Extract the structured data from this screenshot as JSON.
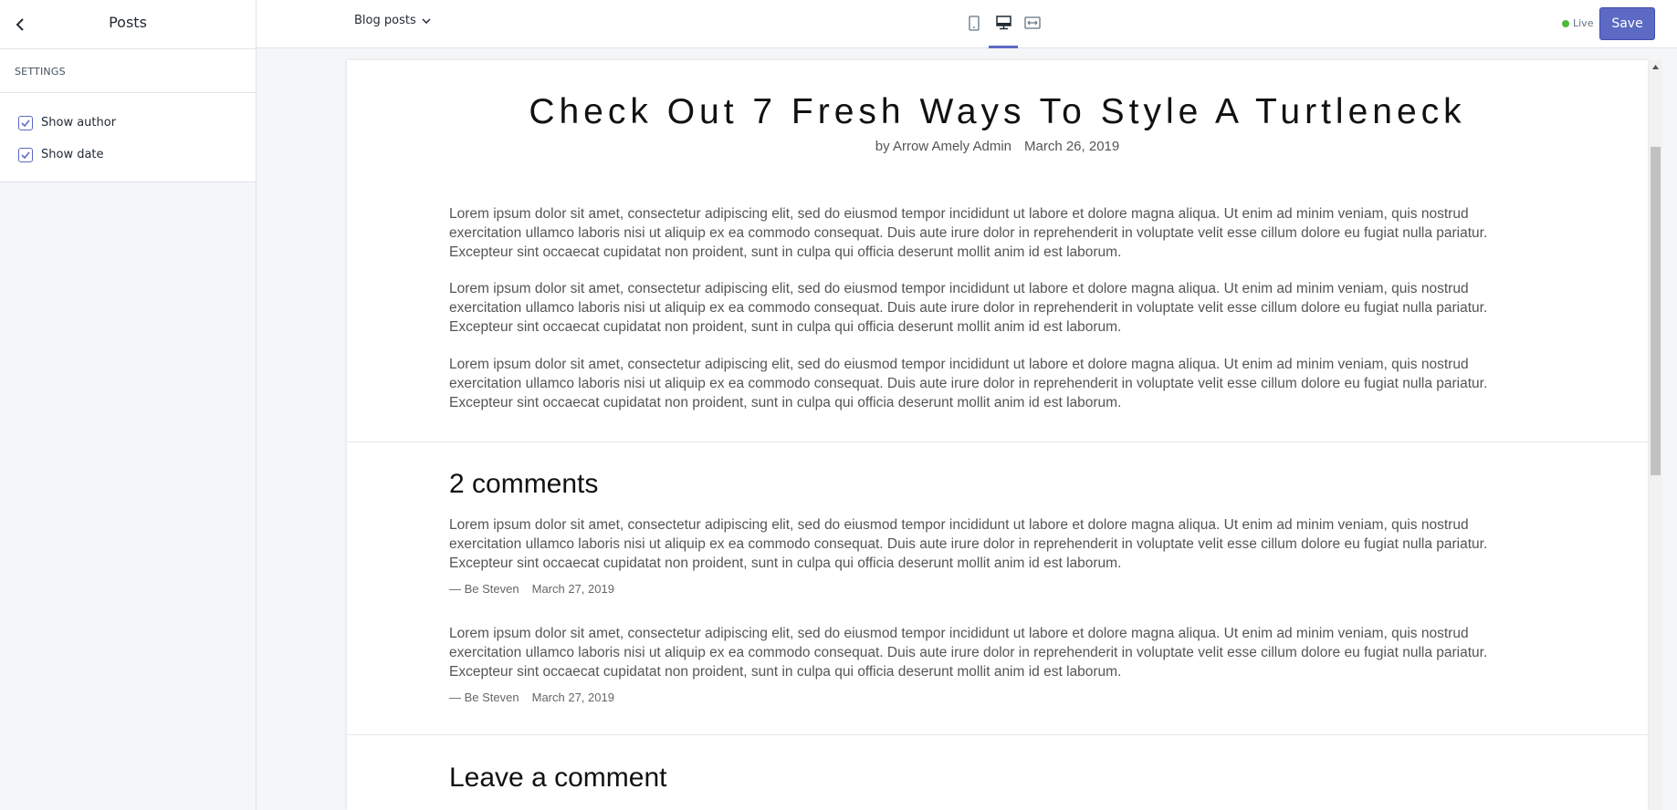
{
  "sidebar": {
    "title": "Posts",
    "section_label": "SETTINGS",
    "options": [
      {
        "label": "Show author",
        "checked": true
      },
      {
        "label": "Show date",
        "checked": true
      }
    ]
  },
  "topbar": {
    "page_select": "Blog posts",
    "views": [
      "mobile-view-icon",
      "desktop-view-icon",
      "fullscreen-view-icon"
    ],
    "active_view": "desktop",
    "status": "Live",
    "save_label": "Save",
    "accent_color": "#5c6ac4",
    "live_color": "#50b83c"
  },
  "article": {
    "title": "Check Out 7 Fresh Ways To Style A Turtleneck",
    "author": "by Arrow Amely Admin",
    "date": "March 26, 2019",
    "paragraphs": [
      "Lorem ipsum dolor sit amet, consectetur adipiscing elit, sed do eiusmod tempor incididunt ut labore et dolore magna aliqua. Ut enim ad minim veniam, quis nostrud exercitation ullamco laboris nisi ut aliquip ex ea commodo consequat. Duis aute irure dolor in reprehenderit in voluptate velit esse cillum dolore eu fugiat nulla pariatur. Excepteur sint occaecat cupidatat non proident, sunt in culpa qui officia deserunt mollit anim id est laborum.",
      "Lorem ipsum dolor sit amet, consectetur adipiscing elit, sed do eiusmod tempor incididunt ut labore et dolore magna aliqua. Ut enim ad minim veniam, quis nostrud exercitation ullamco laboris nisi ut aliquip ex ea commodo consequat. Duis aute irure dolor in reprehenderit in voluptate velit esse cillum dolore eu fugiat nulla pariatur. Excepteur sint occaecat cupidatat non proident, sunt in culpa qui officia deserunt mollit anim id est laborum.",
      "Lorem ipsum dolor sit amet, consectetur adipiscing elit, sed do eiusmod tempor incididunt ut labore et dolore magna aliqua. Ut enim ad minim veniam, quis nostrud exercitation ullamco laboris nisi ut aliquip ex ea commodo consequat. Duis aute irure dolor in reprehenderit in voluptate velit esse cillum dolore eu fugiat nulla pariatur. Excepteur sint occaecat cupidatat non proident, sunt in culpa qui officia deserunt mollit anim id est laborum."
    ]
  },
  "comments": {
    "heading": "2 comments",
    "items": [
      {
        "text": "Lorem ipsum dolor sit amet, consectetur adipiscing elit, sed do eiusmod tempor incididunt ut labore et dolore magna aliqua. Ut enim ad minim veniam, quis nostrud exercitation ullamco laboris nisi ut aliquip ex ea commodo consequat. Duis aute irure dolor in reprehenderit in voluptate velit esse cillum dolore eu fugiat nulla pariatur. Excepteur sint occaecat cupidatat non proident, sunt in culpa qui officia deserunt mollit anim id est laborum.",
        "author": "— Be Steven",
        "date": "March 27, 2019"
      },
      {
        "text": "Lorem ipsum dolor sit amet, consectetur adipiscing elit, sed do eiusmod tempor incididunt ut labore et dolore magna aliqua. Ut enim ad minim veniam, quis nostrud exercitation ullamco laboris nisi ut aliquip ex ea commodo consequat. Duis aute irure dolor in reprehenderit in voluptate velit esse cillum dolore eu fugiat nulla pariatur. Excepteur sint occaecat cupidatat non proident, sunt in culpa qui officia deserunt mollit anim id est laborum.",
        "author": "— Be Steven",
        "date": "March 27, 2019"
      }
    ]
  },
  "leave_comment": {
    "heading": "Leave a comment"
  }
}
